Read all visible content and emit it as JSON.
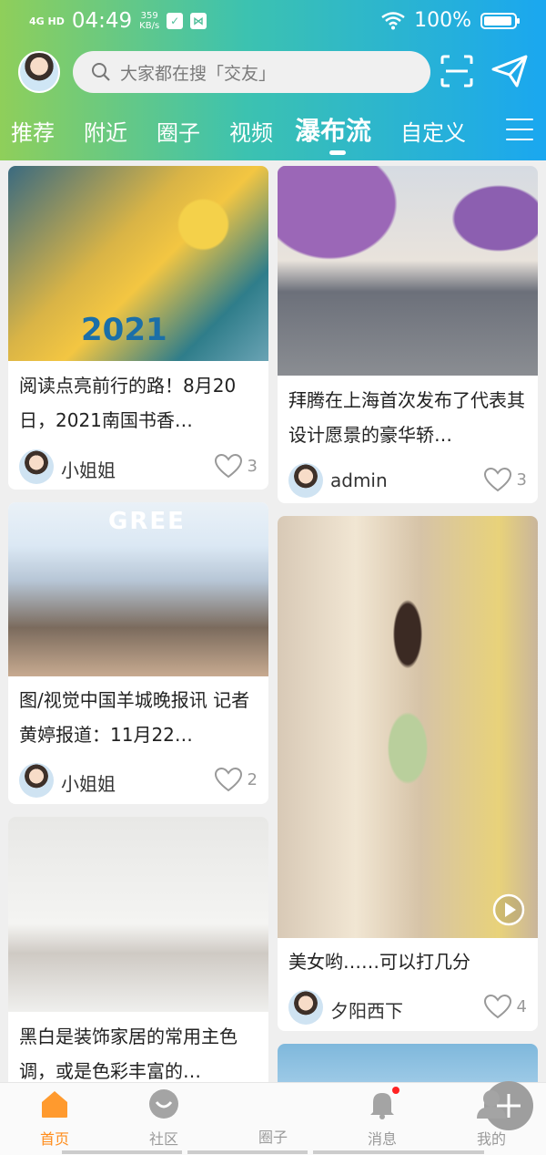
{
  "status_bar": {
    "network": "4G HD",
    "time": "04:49",
    "speed_value": "359",
    "speed_unit": "KB/s",
    "battery": "100%"
  },
  "header": {
    "search_placeholder": "大家都在搜「交友」"
  },
  "tabs": [
    {
      "label": "推荐"
    },
    {
      "label": "附近"
    },
    {
      "label": "圈子"
    },
    {
      "label": "视频"
    },
    {
      "label": "瀑布流",
      "active": true
    },
    {
      "label": "自定义"
    }
  ],
  "feed": {
    "left": [
      {
        "title": "阅读点亮前行的路！8月20日，2021南国书香…",
        "author": "小姐姐",
        "likes": "3",
        "image": "book-fair-booth",
        "image_text": "2021"
      },
      {
        "title": "图/视觉中国羊城晚报讯 记者黄婷报道：11月22…",
        "author": "小姐姐",
        "likes": "2",
        "image": "gree-expo-hall",
        "image_text": "GREE"
      },
      {
        "title": "黑白是装饰家居的常用主色调，或是色彩丰富的…",
        "image": "black-white-living-room"
      }
    ],
    "right": [
      {
        "title": "拜腾在上海首次发布了代表其设计愿景的豪华轿…",
        "author": "admin",
        "likes": "3",
        "image": "purple-sedan"
      },
      {
        "title": "美女哟……可以打几分",
        "author": "夕阳西下",
        "likes": "4",
        "image": "girl-street-video"
      },
      {
        "image": "blue-sky-car"
      }
    ]
  },
  "bottom_nav": [
    {
      "label": "首页",
      "icon": "home-icon",
      "active": true
    },
    {
      "label": "社区",
      "icon": "community-icon"
    },
    {
      "label": "圈子",
      "icon": "plus-icon"
    },
    {
      "label": "消息",
      "icon": "bell-icon",
      "badge": true
    },
    {
      "label": "我的",
      "icon": "profile-icon"
    }
  ],
  "colors": {
    "header_gradient_start": "#8fcf5a",
    "header_gradient_end": "#1aa7f0",
    "active_nav": "#ff8c1a",
    "badge": "#ff2222"
  }
}
